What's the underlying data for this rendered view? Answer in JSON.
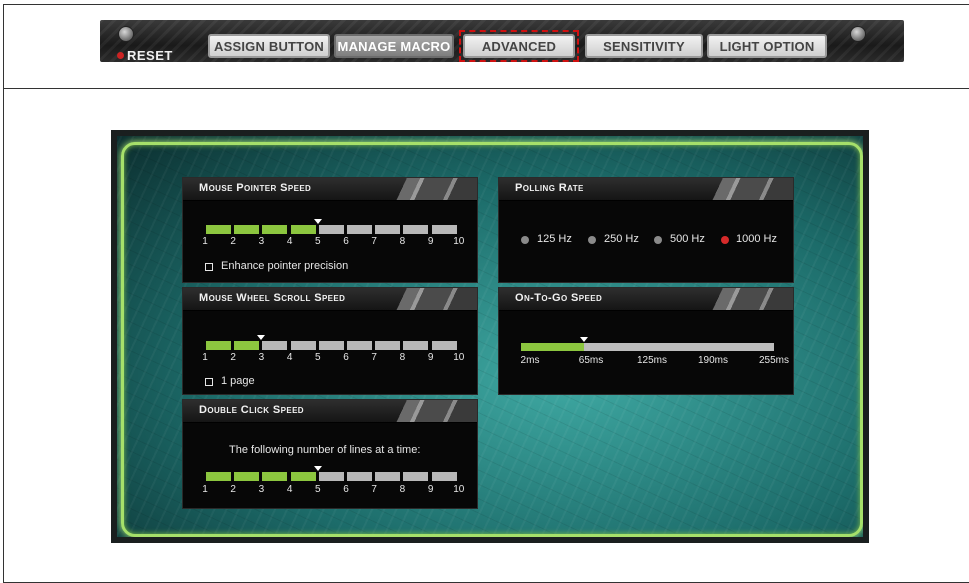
{
  "tabs": {
    "reset": "RESET",
    "items": [
      {
        "label": "ASSIGN BUTTON"
      },
      {
        "label": "MANAGE MACRO"
      },
      {
        "label": "ADVANCED"
      },
      {
        "label": "SENSITIVITY"
      },
      {
        "label": "LIGHT OPTION"
      }
    ],
    "active": "MANAGE MACRO",
    "highlighted": "ADVANCED"
  },
  "mouse_pointer_speed": {
    "title": "Mouse Pointer Speed",
    "ticks": [
      "1",
      "2",
      "3",
      "4",
      "5",
      "6",
      "7",
      "8",
      "9",
      "10"
    ],
    "value": 5,
    "checkbox_label": "Enhance pointer precision"
  },
  "mouse_wheel_scroll_speed": {
    "title": "Mouse Wheel Scroll Speed",
    "ticks": [
      "1",
      "2",
      "3",
      "4",
      "5",
      "6",
      "7",
      "8",
      "9",
      "10"
    ],
    "value": 3,
    "checkbox_label": "1 page"
  },
  "double_click_speed": {
    "title": "Double Click Speed",
    "description": "The following number of lines at a time:",
    "ticks": [
      "1",
      "2",
      "3",
      "4",
      "5",
      "6",
      "7",
      "8",
      "9",
      "10"
    ],
    "value": 5
  },
  "polling_rate": {
    "title": "Polling Rate",
    "options": [
      "125 Hz",
      "250 Hz",
      "500 Hz",
      "1000 Hz"
    ],
    "selected": "1000 Hz"
  },
  "on_to_go_speed": {
    "title": "On-To-Go Speed",
    "ticks": [
      "2ms",
      "65ms",
      "125ms",
      "190ms",
      "255ms"
    ],
    "value_ms": 65,
    "range_ms": [
      2,
      255
    ]
  },
  "colors": {
    "accent_green": "#8cc63f",
    "selected_radio": "#d62a2a",
    "highlight_dashed": "#d01010"
  }
}
